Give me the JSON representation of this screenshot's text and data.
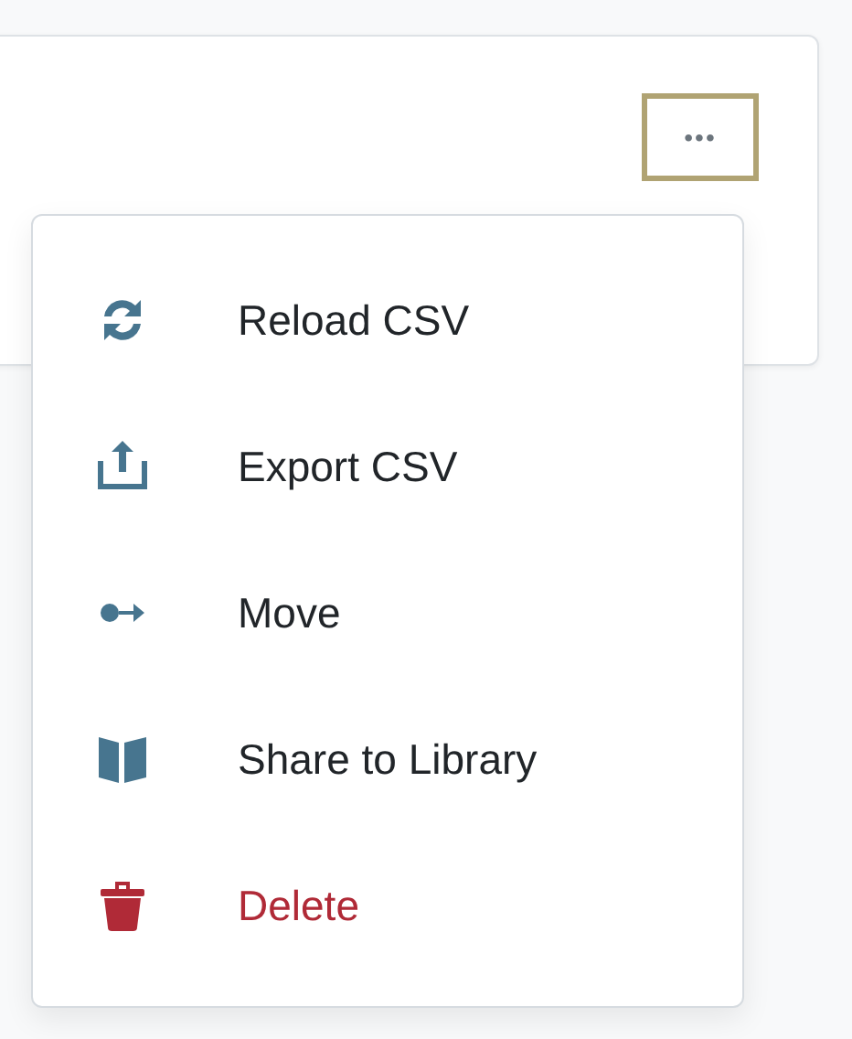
{
  "card": {
    "menu_button": {
      "label": "•••",
      "focused": true
    }
  },
  "menu": {
    "items": [
      {
        "label": "Reload CSV",
        "kind": "default"
      },
      {
        "label": "Export CSV",
        "kind": "default"
      },
      {
        "label": "Move",
        "kind": "default"
      },
      {
        "label": "Share to Library",
        "kind": "default"
      },
      {
        "label": "Delete",
        "kind": "danger"
      }
    ]
  }
}
